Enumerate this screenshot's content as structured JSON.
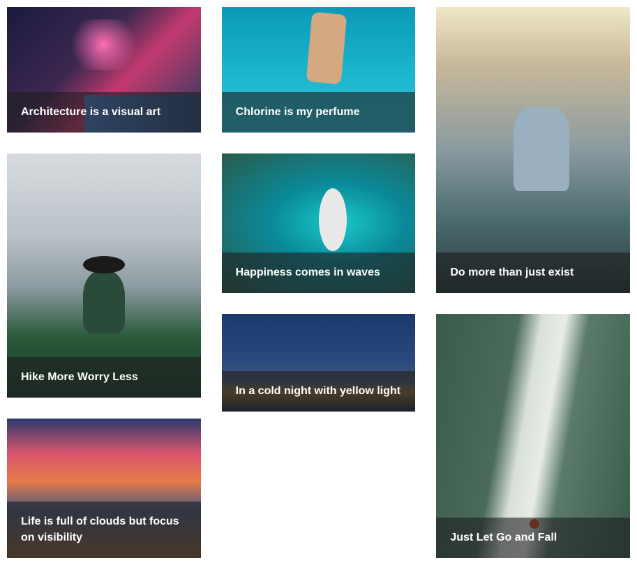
{
  "columns": [
    {
      "cards": [
        {
          "caption": "Architecture is a visual art",
          "img_class": "img-c1-1"
        },
        {
          "caption": "Hike More Worry Less",
          "img_class": "img-c1-2"
        },
        {
          "caption": "Life is full of clouds but focus on visibility",
          "img_class": "img-c1-3"
        }
      ]
    },
    {
      "cards": [
        {
          "caption": "Chlorine is my perfume",
          "img_class": "img-c2-1"
        },
        {
          "caption": "Happiness comes in waves",
          "img_class": "img-c2-2"
        },
        {
          "caption": "In a cold night with yellow light",
          "img_class": "img-c2-3"
        }
      ]
    },
    {
      "cards": [
        {
          "caption": "Do more than just exist",
          "img_class": "img-c3-1"
        },
        {
          "caption": "Just Let Go and Fall",
          "img_class": "img-c3-2"
        }
      ]
    }
  ]
}
